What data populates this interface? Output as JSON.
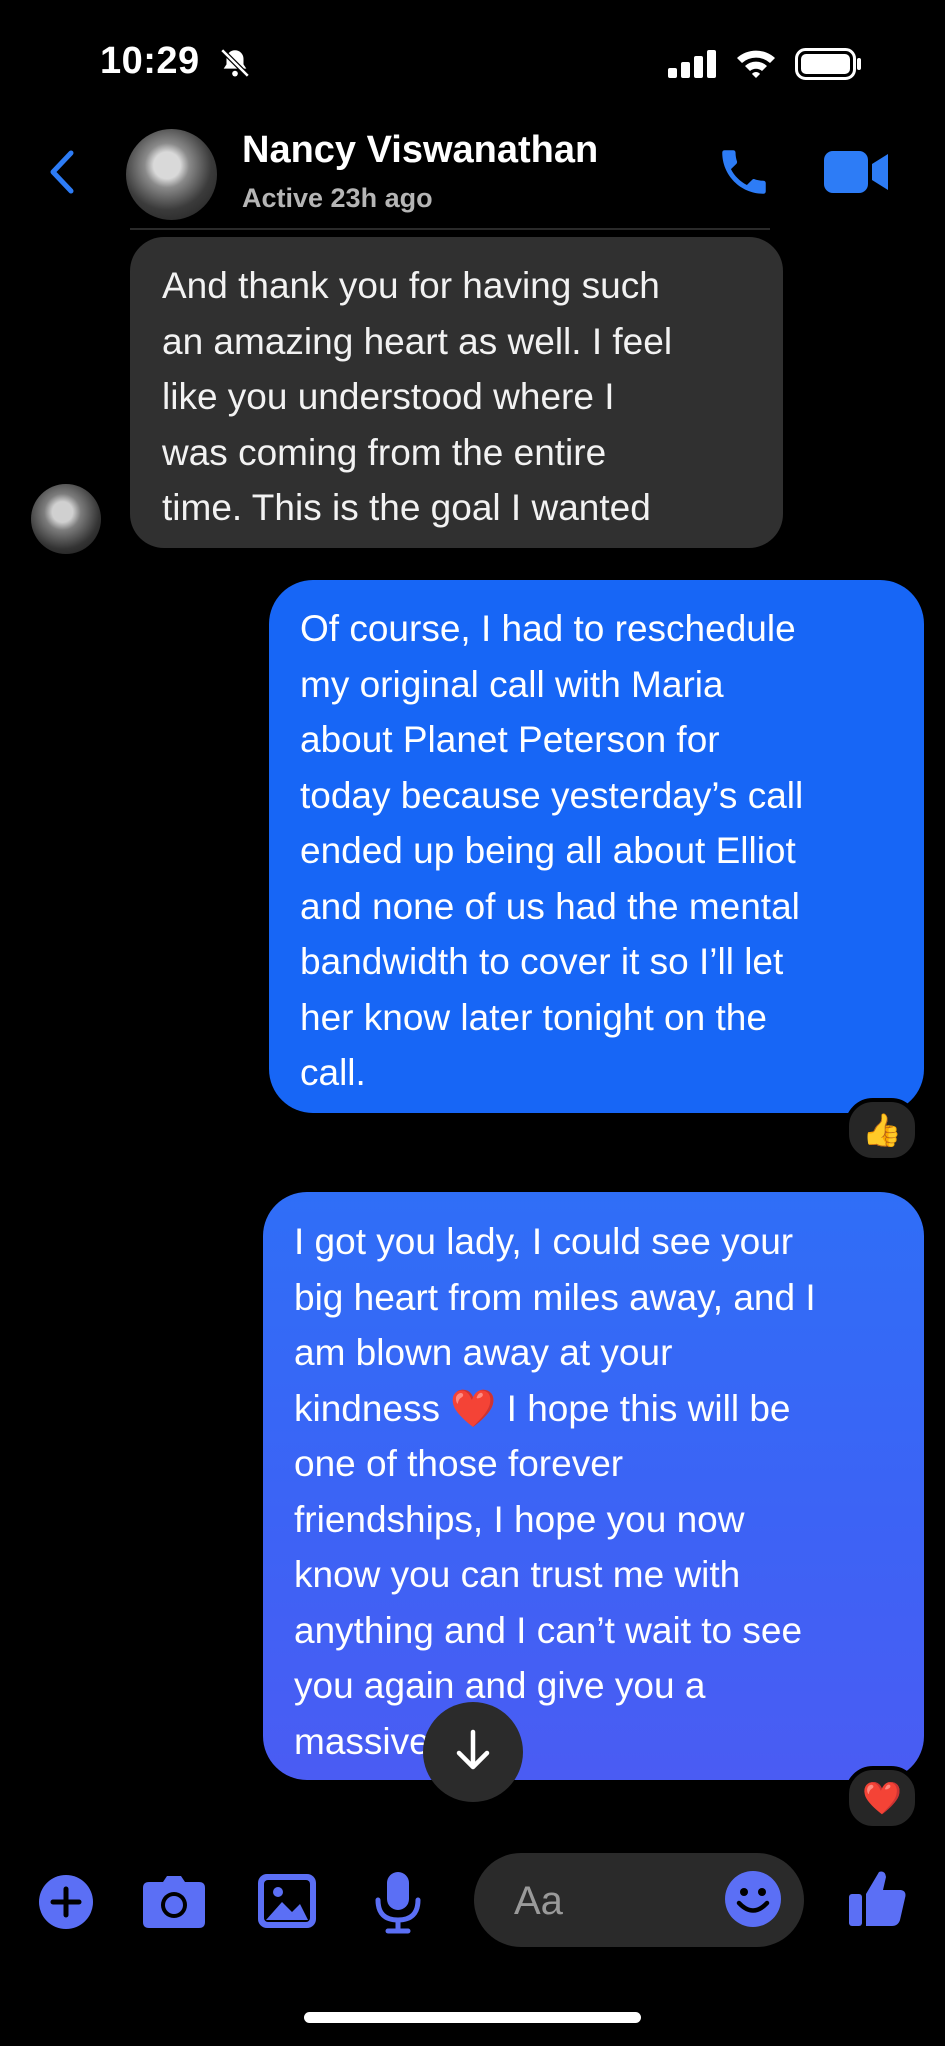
{
  "status_bar": {
    "time": "10:29"
  },
  "header": {
    "contact_name": "Nancy Viswanathan",
    "contact_status": "Active 23h ago"
  },
  "messages": [
    {
      "direction": "incoming",
      "lines": [
        "And thank you for having such",
        "an amazing heart as well. I feel",
        "like you understood where I",
        "was coming from the entire",
        "time. This is the goal I wanted"
      ]
    },
    {
      "direction": "outgoing",
      "lines": [
        "Of course, I had to reschedule",
        "my original call with Maria",
        "about Planet Peterson for",
        "today because yesterday’s call",
        "ended up being all about Elliot",
        "and none of us had the mental",
        "bandwidth to cover it so I’ll let",
        "her know later tonight on the",
        "call."
      ],
      "reaction": "👍"
    },
    {
      "direction": "outgoing",
      "lines": [
        "I got you lady, I could see your",
        "big heart from miles away, and I",
        "am blown away at your",
        "kindness ❤️ I hope this will be",
        "one of those forever",
        "friendships, I hope you now",
        "know you can trust me with",
        "anything and I can’t wait to see",
        "you again and give you a",
        "massive hug!"
      ],
      "reaction": "❤️"
    }
  ],
  "composer": {
    "placeholder": "Aa"
  },
  "colors": {
    "accent": "#5b6ff5",
    "header_icon": "#2d7cf6",
    "outgoing_bubble": "#1766f6",
    "incoming_bubble": "#303030"
  },
  "icons": [
    "bell-slash-icon",
    "signal-icon",
    "wifi-icon",
    "battery-icon",
    "back-chevron-icon",
    "phone-icon",
    "video-camera-icon",
    "arrow-down-icon",
    "plus-icon",
    "camera-icon",
    "gallery-icon",
    "microphone-icon",
    "emoji-icon",
    "thumbs-up-icon"
  ]
}
